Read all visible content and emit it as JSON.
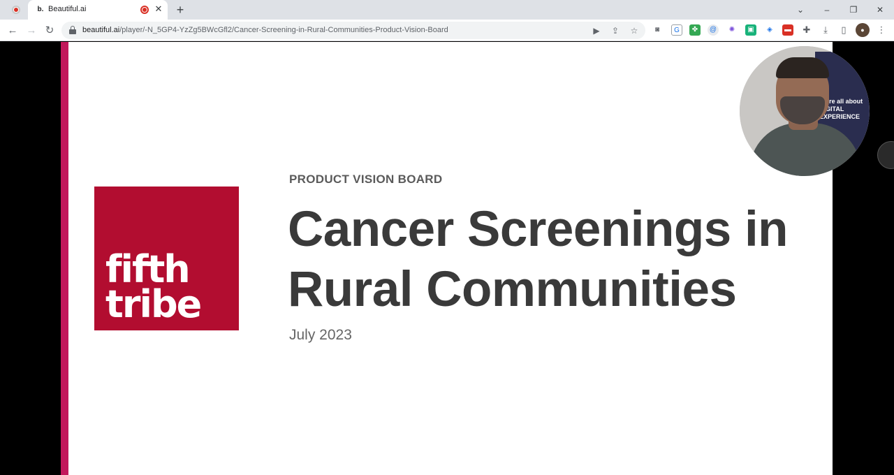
{
  "browser": {
    "tab": {
      "favicon": "b.",
      "title": "Beautiful.ai",
      "close": "✕"
    },
    "new_tab": "+",
    "url_host": "beautiful.ai",
    "url_path": "/player/-N_5GP4-YzZg5BWcGfl2/Cancer-Screening-in-Rural-Communities-Product-Vision-Board",
    "window_controls": {
      "collapse": "⌄",
      "minimize": "–",
      "restore": "❐",
      "close": "✕"
    },
    "nav": {
      "back": "←",
      "forward": "→",
      "reload": "↻"
    },
    "omnibox_icons": [
      "video-camera-icon",
      "share-icon",
      "star-icon"
    ],
    "extension_icons": [
      "camera-icon",
      "extension-g-icon",
      "extension-clover-icon",
      "extension-at-icon",
      "extension-gear-icon",
      "extension-green-icon",
      "extension-blue-icon",
      "extension-red-icon"
    ],
    "toolbar_icons": [
      "puzzle-icon",
      "download-icon",
      "sidepanel-icon",
      "avatar",
      "menu-icon"
    ]
  },
  "slide": {
    "logo_line1": "fifth",
    "logo_line2": "tribe",
    "kicker": "PRODUCT VISION BOARD",
    "title": "Cancer Screenings in Rural Communities",
    "date": "July 2023",
    "accent_color": "#c2185b",
    "logo_color": "#b20d30"
  },
  "webcam": {
    "banner_text_1": "we're all about",
    "banner_text_2": "DIGITAL",
    "banner_text_3": "EXPERIENCE"
  }
}
